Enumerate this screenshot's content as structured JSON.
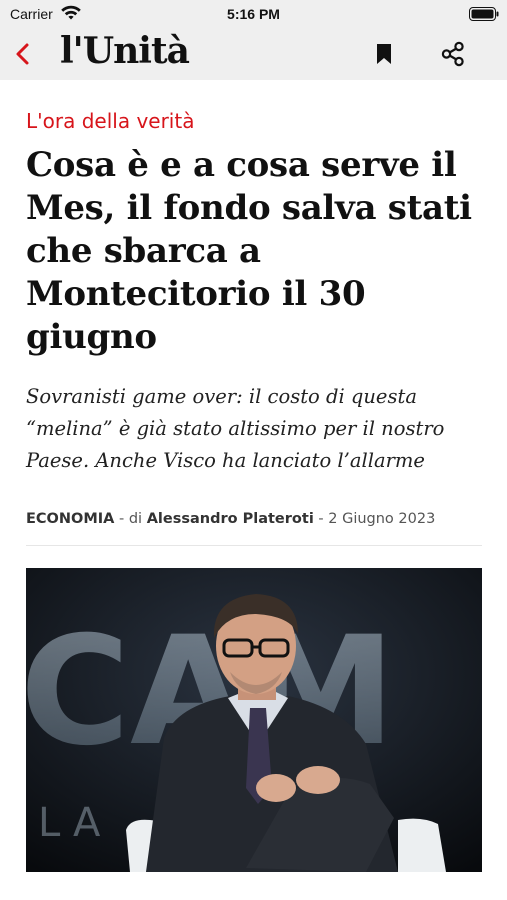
{
  "status_bar": {
    "carrier": "Carrier",
    "time": "5:16 PM"
  },
  "nav": {
    "logo": "l'Unità",
    "back_icon": "chevron-left-icon",
    "bookmark_icon": "bookmark-icon",
    "share_icon": "share-icon",
    "accent_color": "#d7151b"
  },
  "article": {
    "kicker": "L'ora della verità",
    "headline": "Cosa è e a cosa serve il Mes, il fondo salva stati che sbarca a Montecitorio il 30 giugno",
    "subtitle": "Sovranisti game over: il costo di questa “melina” è già stato altissimo per il nostro Paese. Anche Visco ha lanciato l’allarme",
    "byline": {
      "section": "ECONOMIA",
      "by_prefix": "- di",
      "author": "Alessandro Plateroti",
      "date_sep": "-",
      "date": "2 Giugno 2023"
    },
    "photo": {
      "backdrop_letters": "CAM",
      "backdrop_letters_small": "L A"
    }
  }
}
